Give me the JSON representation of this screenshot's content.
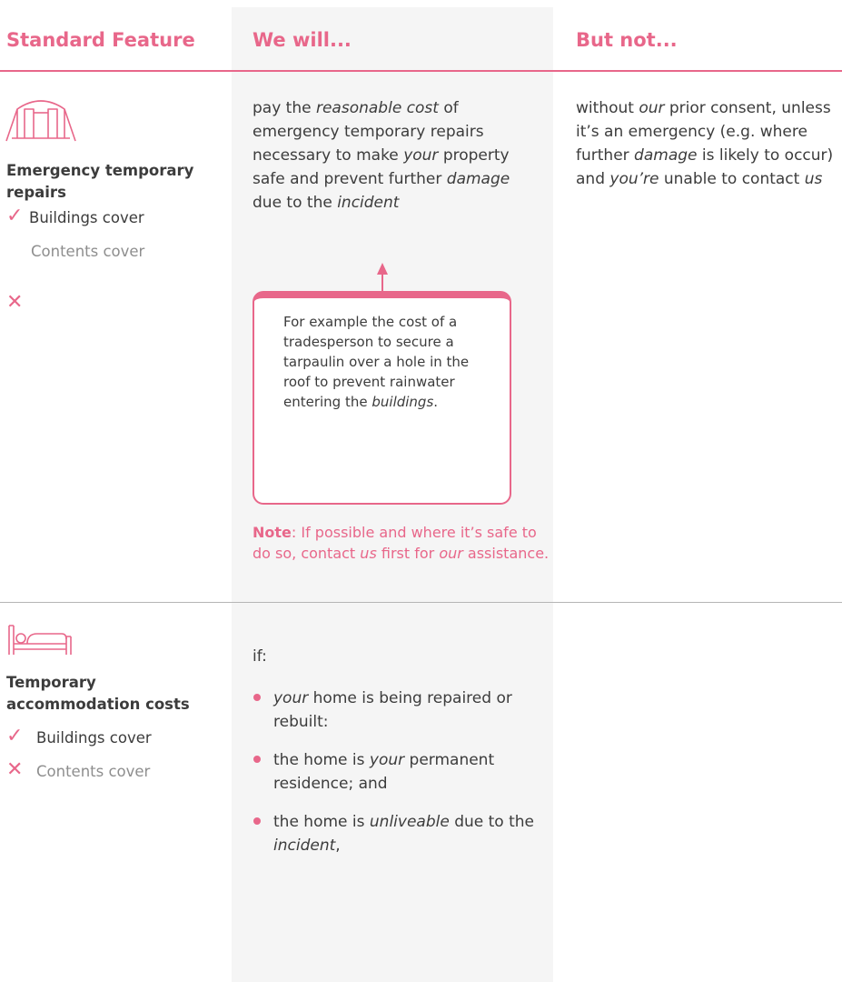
{
  "colors": {
    "accent": "#e8678a",
    "text": "#3c3c3c",
    "muted": "#8e8e8e",
    "column_bg": "#f5f5f5"
  },
  "headers": {
    "feature": "Standard Feature",
    "will": "We will...",
    "not": "But not..."
  },
  "rows": [
    {
      "icon": "emergency-repair-icon",
      "title": "Emergency temporary repairs",
      "covers": [
        {
          "label": "Buildings cover",
          "included": true,
          "mark": "✓"
        },
        {
          "label": "Contents cover",
          "included": false,
          "mark": "✕"
        }
      ],
      "will": [
        {
          "t": "pay the "
        },
        {
          "t": "reasonable cost",
          "i": true
        },
        {
          "t": " of emergency temporary repairs necessary to make "
        },
        {
          "t": "your",
          "i": true
        },
        {
          "t": " property safe and prevent further "
        },
        {
          "t": "damage",
          "i": true
        },
        {
          "t": " due to the "
        },
        {
          "t": "incident",
          "i": true
        }
      ],
      "callout": [
        {
          "t": "For example the cost of a tradesperson to secure a tarpaulin over a hole in the roof to prevent rainwater entering the "
        },
        {
          "t": "buildings",
          "i": true
        },
        {
          "t": "."
        }
      ],
      "note_label": "Note",
      "note": [
        {
          "t": ": If possible and where it’s safe to do so, contact "
        },
        {
          "t": "us",
          "i": true
        },
        {
          "t": " first for "
        },
        {
          "t": "our",
          "i": true
        },
        {
          "t": " assistance."
        }
      ],
      "not": [
        {
          "t": "without "
        },
        {
          "t": "our",
          "i": true
        },
        {
          "t": " prior consent, unless it’s an emergency (e.g. where further "
        },
        {
          "t": "damage",
          "i": true
        },
        {
          "t": " is likely to occur) and "
        },
        {
          "t": "you’re",
          "i": true
        },
        {
          "t": " unable to contact "
        },
        {
          "t": "us",
          "i": true
        }
      ]
    },
    {
      "icon": "bed-icon",
      "title": "Temporary accommodation costs",
      "covers": [
        {
          "label": "Buildings cover",
          "included": true,
          "mark": "✓"
        },
        {
          "label": "Contents cover",
          "included": false,
          "mark": "✕"
        }
      ],
      "intro": "if:",
      "bullets": [
        [
          {
            "t": "your",
            "i": true
          },
          {
            "t": " home is being repaired or rebuilt:"
          }
        ],
        [
          {
            "t": "the home is "
          },
          {
            "t": "your",
            "i": true
          },
          {
            "t": " permanent residence; and"
          }
        ],
        [
          {
            "t": "the home is "
          },
          {
            "t": "unliveable",
            "i": true
          },
          {
            "t": " due to the "
          },
          {
            "t": "incident",
            "i": true
          },
          {
            "t": ","
          }
        ]
      ]
    }
  ]
}
